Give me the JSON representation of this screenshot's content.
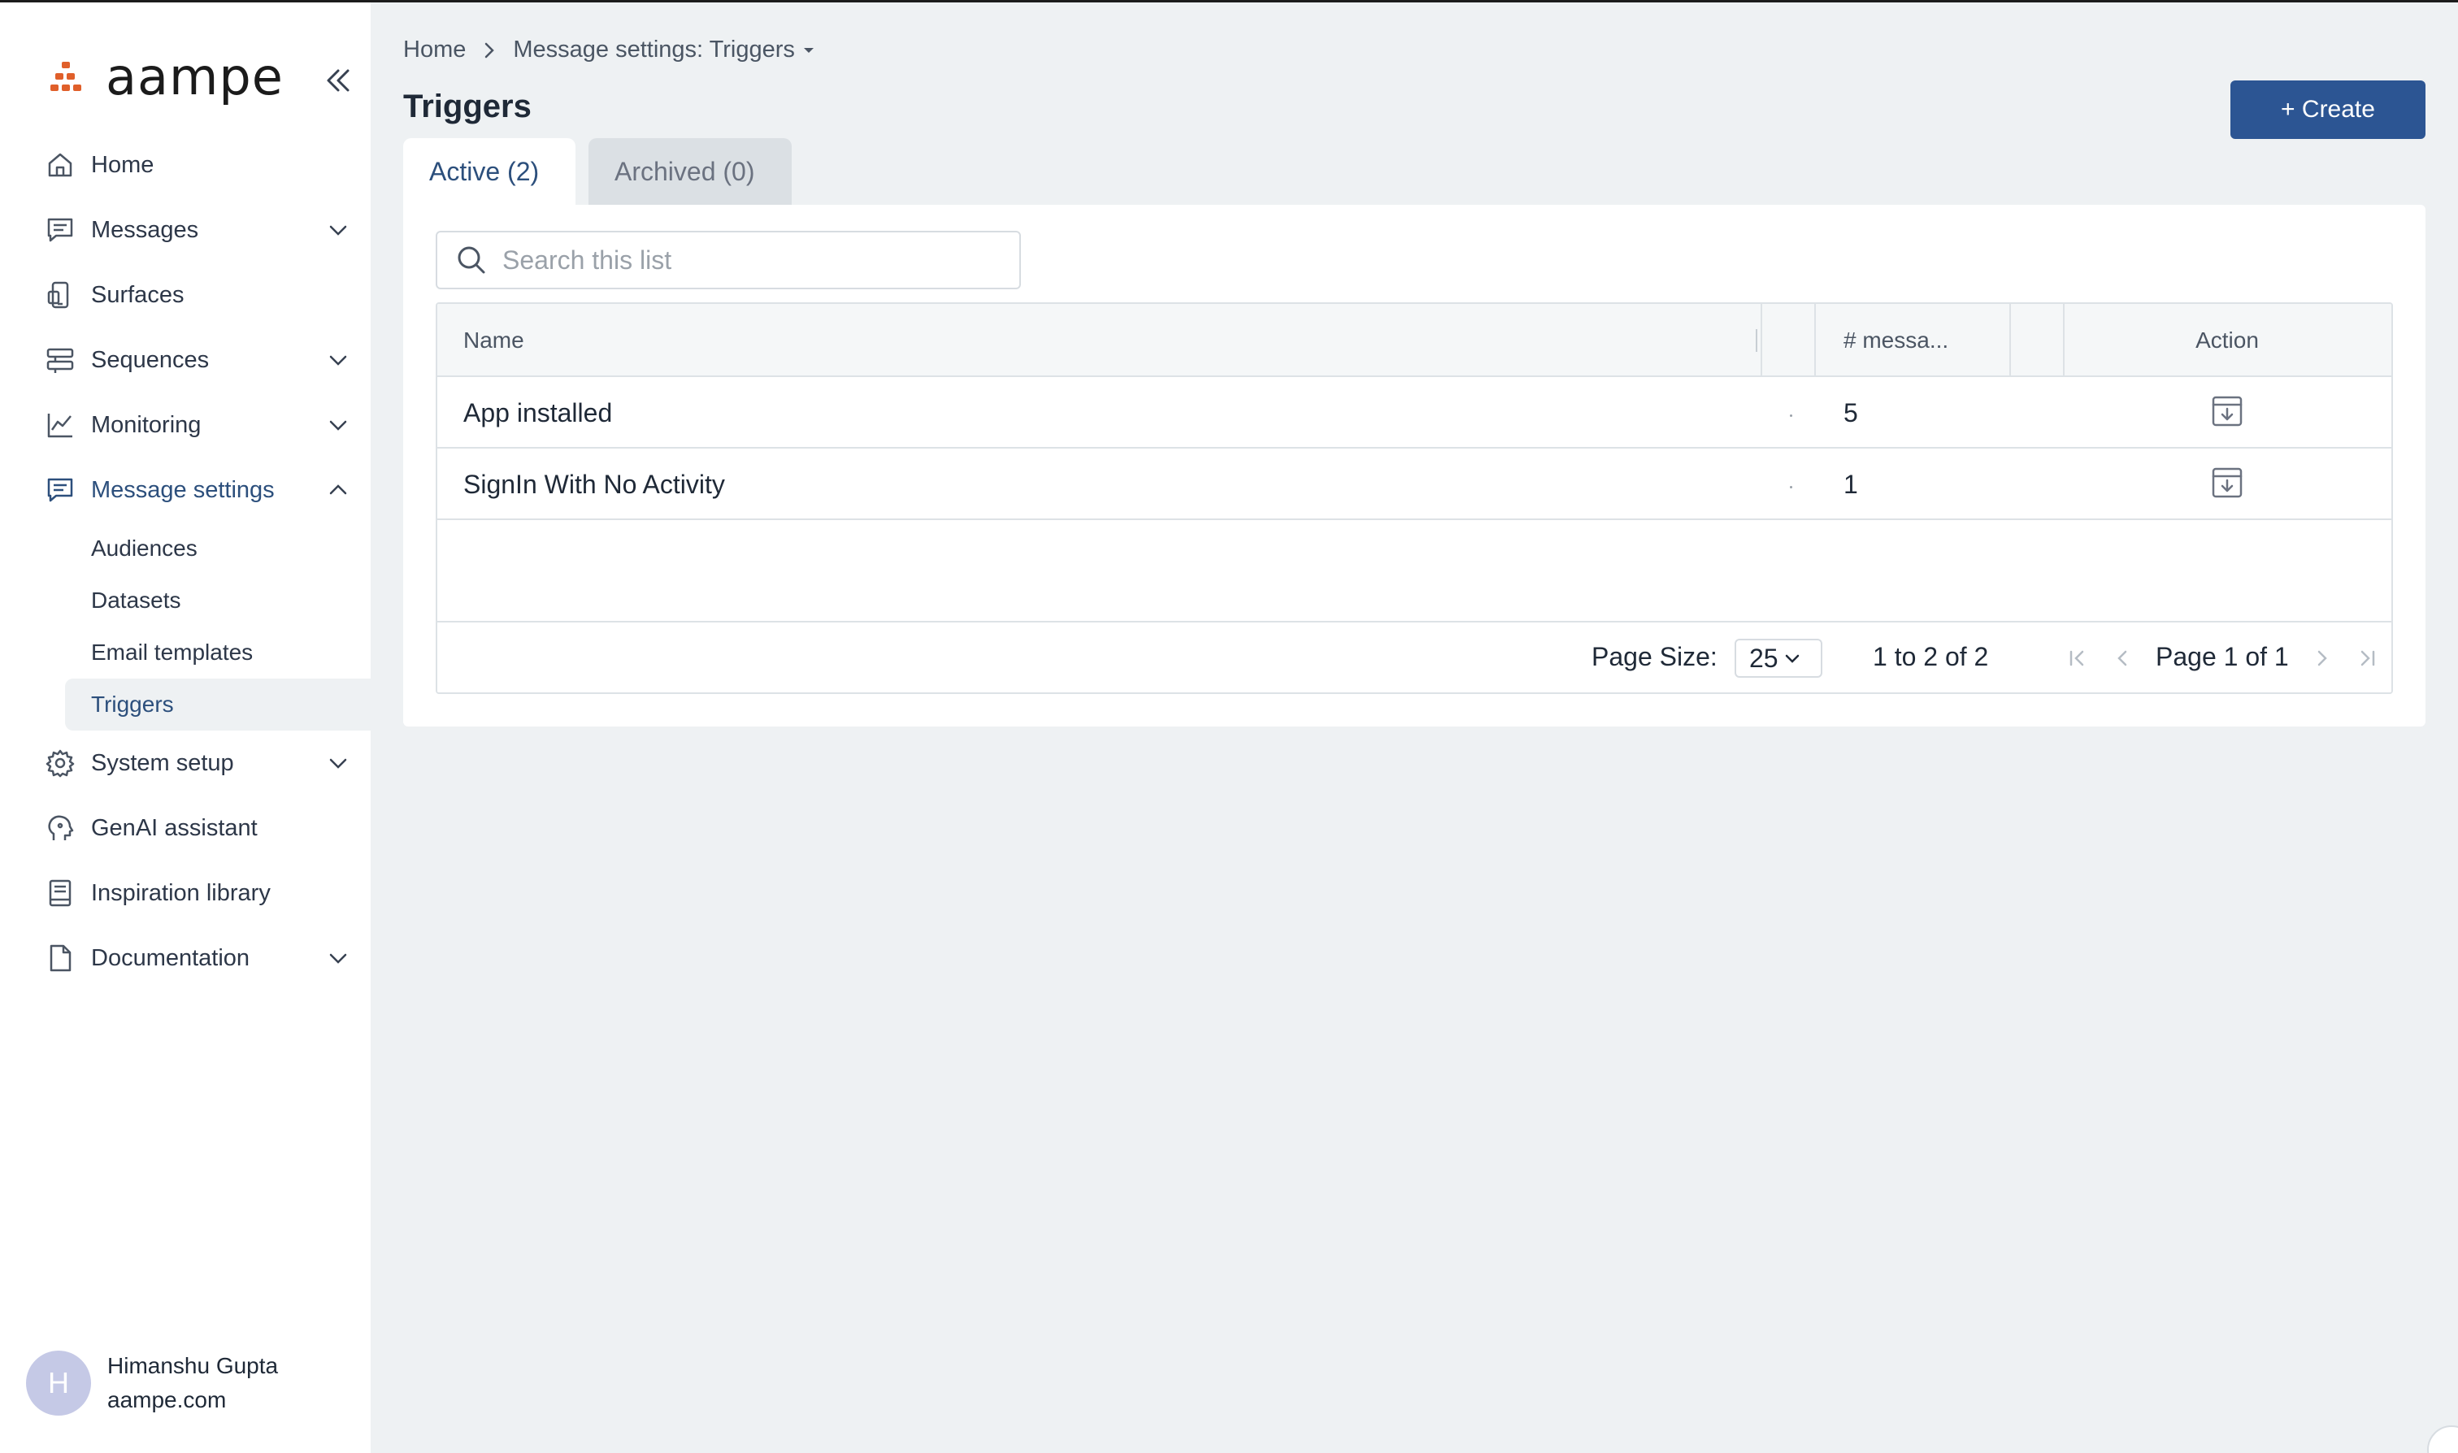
{
  "app": {
    "logo_text": "aampe"
  },
  "sidebar": {
    "items": [
      {
        "label": "Home",
        "icon": "home-icon"
      },
      {
        "label": "Messages",
        "icon": "message-icon"
      },
      {
        "label": "Surfaces",
        "icon": "surfaces-icon"
      },
      {
        "label": "Sequences",
        "icon": "sequences-icon"
      },
      {
        "label": "Monitoring",
        "icon": "chart-line-icon"
      },
      {
        "label": "Message settings",
        "icon": "message-settings-icon"
      },
      {
        "label": "System setup",
        "icon": "gear-icon"
      },
      {
        "label": "GenAI assistant",
        "icon": "genai-icon"
      },
      {
        "label": "Inspiration library",
        "icon": "book-icon"
      },
      {
        "label": "Documentation",
        "icon": "document-icon"
      }
    ],
    "sub_items": [
      "Audiences",
      "Datasets",
      "Email templates",
      "Triggers"
    ],
    "selected_sub": "Triggers"
  },
  "user": {
    "initial": "H",
    "name": "Himanshu Gupta",
    "org": "aampe.com"
  },
  "breadcrumb": {
    "home": "Home",
    "current": "Message settings: Triggers"
  },
  "page": {
    "title": "Triggers",
    "create_label": "+ Create"
  },
  "tabs": [
    {
      "label": "Active (2)",
      "active": true
    },
    {
      "label": "Archived (0)",
      "active": false
    }
  ],
  "search": {
    "placeholder": "Search this list",
    "value": ""
  },
  "table": {
    "columns": [
      "Name",
      "# messa...",
      "Action"
    ],
    "rows": [
      {
        "name": "App installed",
        "messages": "5"
      },
      {
        "name": "SignIn With No Activity",
        "messages": "1"
      }
    ]
  },
  "pagination": {
    "page_size_label": "Page Size:",
    "page_size": "25",
    "range_prefix": "1",
    "range_to": "to",
    "range_end": "2",
    "range_of": "of",
    "range_total": "2",
    "page_word": "Page",
    "page_current": "1",
    "page_of": "of",
    "page_total": "1"
  },
  "colors": {
    "accent": "#2c5593",
    "brand_orange": "#e05f2a",
    "active_nav": "#2c4f7c"
  }
}
